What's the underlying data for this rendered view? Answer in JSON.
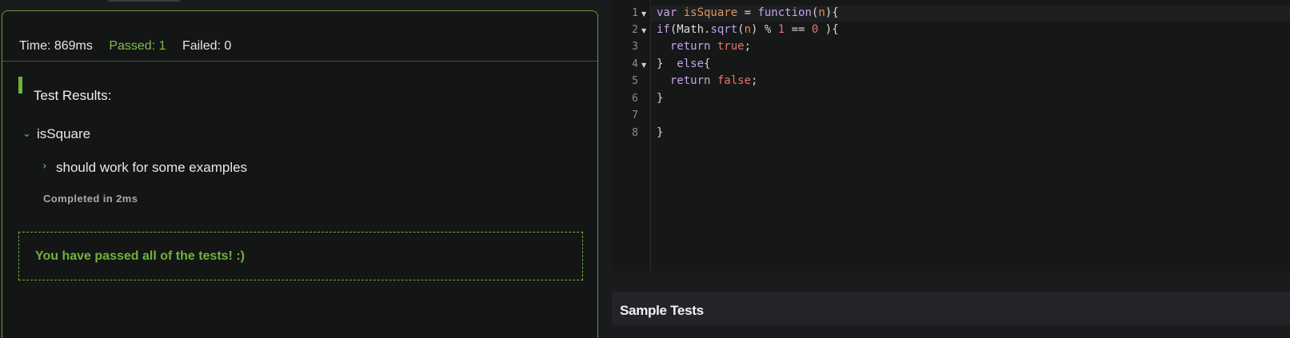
{
  "stats": {
    "time": "Time: 869ms",
    "passed": "Passed: 1",
    "failed": "Failed: 0"
  },
  "results": {
    "title": "Test Results:",
    "suite": "isSquare",
    "case": "should work for some examples",
    "completed": "Completed in 2ms",
    "message": "You have passed all of the tests! :)"
  },
  "editor": {
    "line_numbers": [
      "1",
      "2",
      "3",
      "4",
      "5",
      "6",
      "7",
      "8"
    ],
    "tokens": {
      "l1_var": "var ",
      "l1_name": "isSquare",
      "l1_eq": " = ",
      "l1_function": "function",
      "l1_open": "(",
      "l1_param": "n",
      "l1_close": "){",
      "l2_if": "if",
      "l2_open": "(",
      "l2_math": "Math",
      "l2_dot": ".",
      "l2_sqrt": "sqrt",
      "l2_p1": "(",
      "l2_n": "n",
      "l2_p2": ") ",
      "l2_mod": "% ",
      "l2_one": "1",
      "l2_eqeq": " == ",
      "l2_zero": "0",
      "l2_end": " ){",
      "l3_return": "  return ",
      "l3_true": "true",
      "l3_semi": ";",
      "l4_brace": "}  ",
      "l4_else": "else",
      "l4_open": "{",
      "l5_return": "  return ",
      "l5_false": "false",
      "l5_semi": ";",
      "l6": "}",
      "l8": "}"
    }
  },
  "sample_tests": {
    "title": "Sample Tests"
  },
  "colors": {
    "accent_green": "#6fb33a",
    "passed_text": "#7fbf4d",
    "border_green": "#6e9937"
  }
}
